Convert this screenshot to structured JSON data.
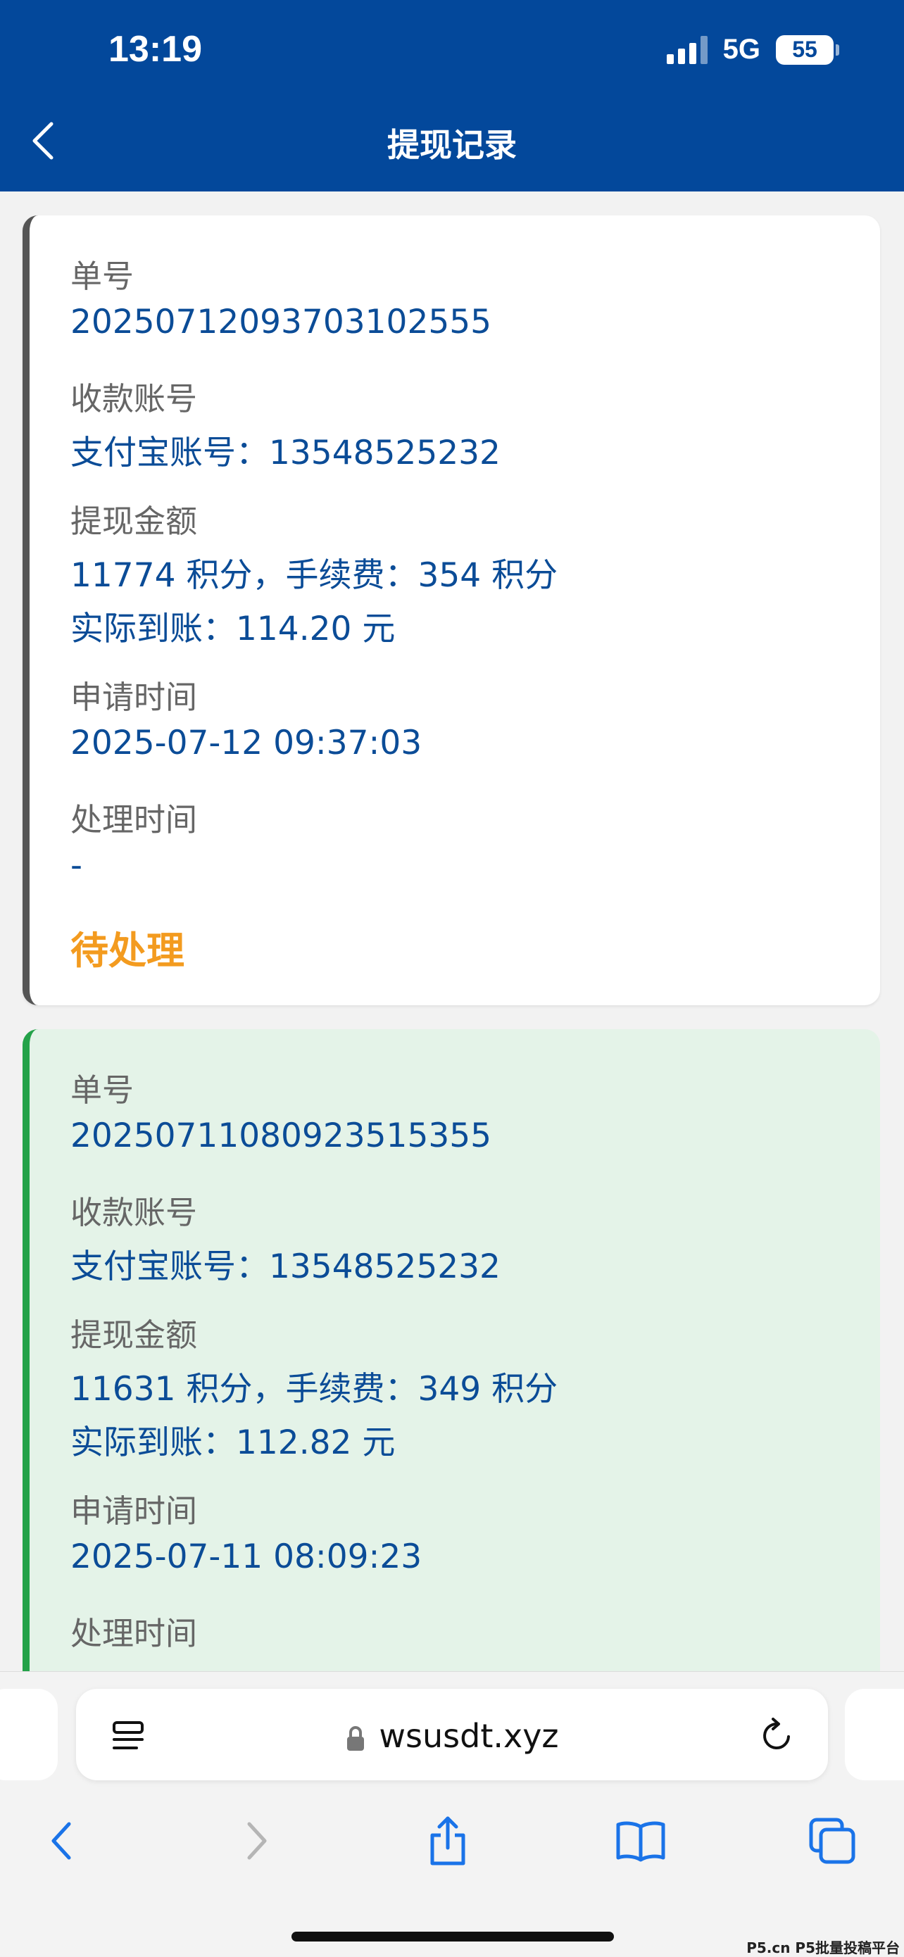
{
  "status_bar": {
    "time": "13:19",
    "network": "5G",
    "battery": "55"
  },
  "header": {
    "title": "提现记录"
  },
  "records": [
    {
      "order_label": "单号",
      "order_no": "20250712093703102555",
      "account_label": "收款账号",
      "account": "支付宝账号：13548525232",
      "amount_label": "提现金额",
      "amount": "11774 积分，手续费：354 积分",
      "actual": "实际到账：114.20 元",
      "apply_label": "申请时间",
      "apply_time": "2025-07-12 09:37:03",
      "process_label": "处理时间",
      "process_time": "-",
      "status": "待处理",
      "status_color": "#f39b1f",
      "accent_color": "#555555"
    },
    {
      "order_label": "单号",
      "order_no": "20250711080923515355",
      "account_label": "收款账号",
      "account": "支付宝账号：13548525232",
      "amount_label": "提现金额",
      "amount": "11631 积分，手续费：349 积分",
      "actual": "实际到账：112.82 元",
      "apply_label": "申请时间",
      "apply_time": "2025-07-11 08:09:23",
      "process_label": "处理时间",
      "accent_color": "#24a249",
      "background_color": "#e4f3e8"
    }
  ],
  "browser": {
    "url": "wsusdt.xyz"
  },
  "watermark": "P5.cn P5批量投稿平台",
  "colors": {
    "header_bg": "#03489b",
    "value_text": "#0b4c97",
    "label_text": "#666666"
  }
}
